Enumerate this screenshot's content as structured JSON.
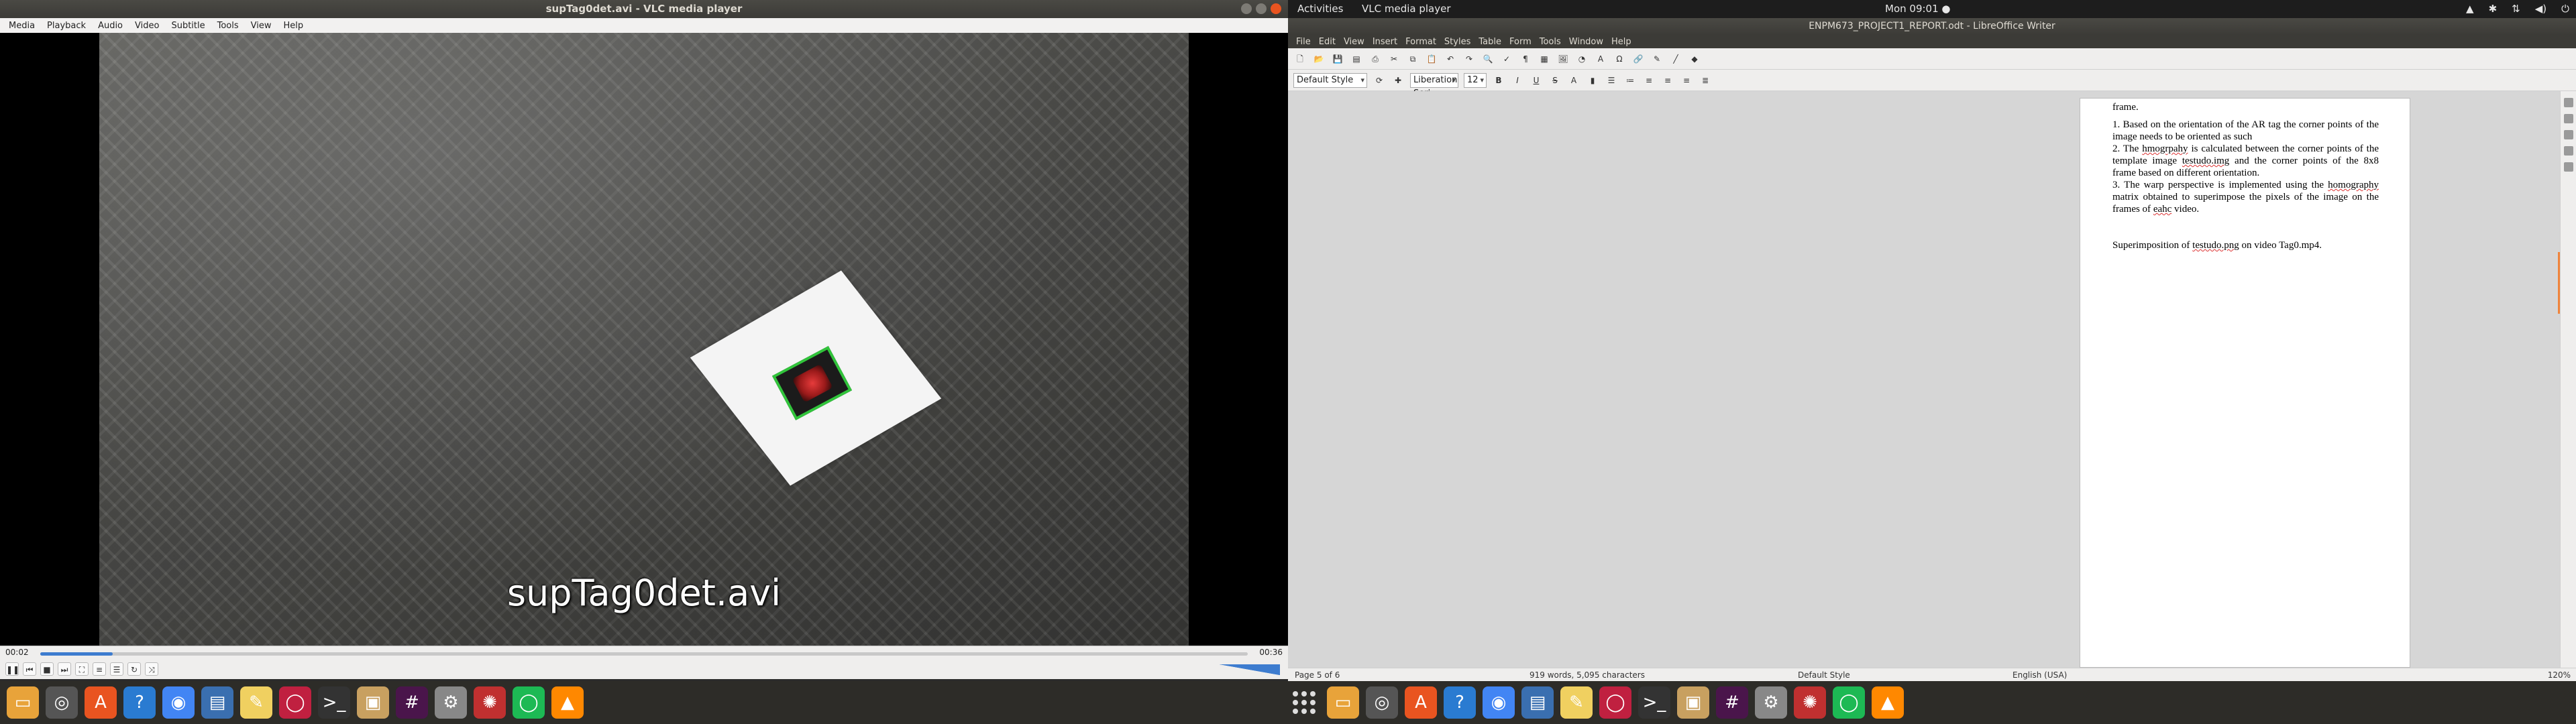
{
  "vlc": {
    "title": "supTag0det.avi - VLC media player",
    "menu": [
      "Media",
      "Playback",
      "Audio",
      "Video",
      "Subtitle",
      "Tools",
      "View",
      "Help"
    ],
    "overlay_text": "supTag0det.avi",
    "time_current": "00:02",
    "time_total": "00:36",
    "progress": 0.06,
    "volume_icon": "speaker-icon"
  },
  "gnome": {
    "activities": "Activities",
    "app_menu": "VLC media player",
    "clock": "Mon 09:01 ●"
  },
  "writer": {
    "title": "ENPM673_PROJECT1_REPORT.odt - LibreOffice Writer",
    "menu": [
      "File",
      "Edit",
      "View",
      "Insert",
      "Format",
      "Styles",
      "Table",
      "Form",
      "Tools",
      "Window",
      "Help"
    ],
    "style": "Default Style",
    "font": "Liberation Seri",
    "size": "12",
    "doc": {
      "line0": "frame.",
      "p1": "1. Based on the orientation of the AR tag the corner points of the image needs to be oriented as such",
      "p2a": "2. The ",
      "p2b": "hmogrpahy",
      "p2c": " is calculated between the corner points of the template image ",
      "p2d": "testudo.img",
      "p2e": " and the corner points of the 8x8 frame based on different orientation.",
      "p3a": "3. The warp perspective is implemented using the ",
      "p3b": "homography",
      "p3c": " matrix obtained to superimpose the pixels of the image on the frames of ",
      "p3d": "eahc",
      "p3e": " video.",
      "p4a": "Superimposition of ",
      "p4b": "testudo.png",
      "p4c": " on video Tag0.mp4."
    },
    "status": {
      "page": "Page 5 of 6",
      "words": "919 words, 5,095 characters",
      "style": "Default Style",
      "lang": "English (USA)",
      "zoom": "120%"
    }
  },
  "taskbar_left": [
    "files-icon",
    "disk-icon",
    "software-center-icon",
    "help-icon",
    "chrome-icon",
    "document-viewer-icon",
    "text-editor-icon",
    "debian-icon",
    "terminal-icon",
    "archive-icon",
    "slack-icon",
    "settings-icon",
    "ros-icon",
    "spotify-icon",
    "vlc-icon"
  ],
  "taskbar_right": [
    "files-icon",
    "disk-icon",
    "software-center-icon",
    "help-icon",
    "chrome-icon",
    "document-viewer-icon",
    "text-editor-icon",
    "debian-icon",
    "terminal-icon",
    "archive-icon",
    "slack-icon",
    "settings-icon",
    "ros-icon",
    "spotify-icon",
    "vlc-icon"
  ]
}
